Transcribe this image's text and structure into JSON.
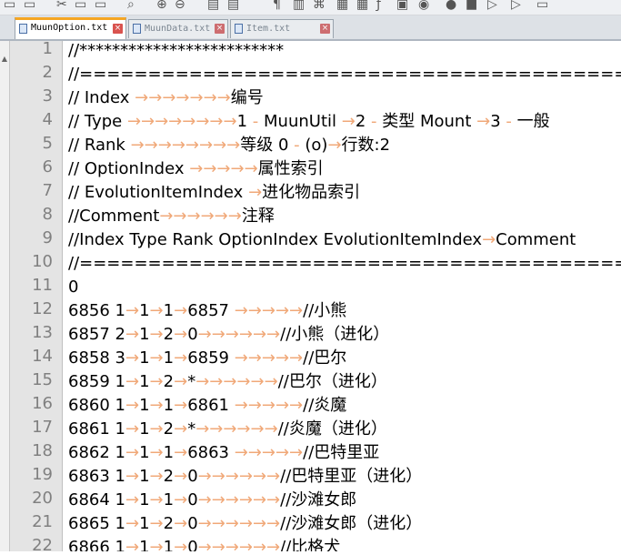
{
  "tabs": [
    {
      "label": "MuunOption.txt",
      "active": true
    },
    {
      "label": "MuunData.txt",
      "active": false
    },
    {
      "label": "Item.txt",
      "active": false
    }
  ],
  "close_glyph": "×",
  "line_numbers": [
    "1",
    "2",
    "3",
    "4",
    "5",
    "6",
    "7",
    "8",
    "9",
    "10",
    "11",
    "12",
    "13",
    "14",
    "15",
    "16",
    "17",
    "18",
    "19",
    "20",
    "21",
    "22"
  ],
  "lines": [
    [
      {
        "t": "//*************************"
      }
    ],
    [
      {
        "t": "//==================================================="
      }
    ],
    [
      {
        "t": "//"
      },
      {
        "w": " "
      },
      {
        "t": "Index"
      },
      {
        "a": " →→→→→→→"
      },
      {
        "t": "编号"
      }
    ],
    [
      {
        "t": "//"
      },
      {
        "w": " "
      },
      {
        "t": "Type"
      },
      {
        "a": " →→→→→→→→"
      },
      {
        "t": "1"
      },
      {
        "w": " - "
      },
      {
        "t": "MuunUtil"
      },
      {
        "a": " →"
      },
      {
        "t": "2"
      },
      {
        "w": " - "
      },
      {
        "t": "类型"
      },
      {
        "w": " "
      },
      {
        "t": "Mount"
      },
      {
        "a": " →"
      },
      {
        "t": "3"
      },
      {
        "w": " - "
      },
      {
        "t": "一般"
      }
    ],
    [
      {
        "t": "//"
      },
      {
        "w": " "
      },
      {
        "t": "Rank"
      },
      {
        "a": " →→→→→→→→"
      },
      {
        "t": "等级"
      },
      {
        "w": " "
      },
      {
        "t": "0"
      },
      {
        "w": " - "
      },
      {
        "t": "(o)"
      },
      {
        "a": "→"
      },
      {
        "t": "行数:2"
      }
    ],
    [
      {
        "t": "//"
      },
      {
        "w": " "
      },
      {
        "t": "OptionIndex"
      },
      {
        "a": " →→→→→"
      },
      {
        "t": "属性索引"
      }
    ],
    [
      {
        "t": "//"
      },
      {
        "w": " "
      },
      {
        "t": "EvolutionItemIndex"
      },
      {
        "a": " →"
      },
      {
        "t": "进化物品索引"
      }
    ],
    [
      {
        "t": "//Comment"
      },
      {
        "a": "→→→→→→"
      },
      {
        "t": "注释"
      }
    ],
    [
      {
        "t": "//Index"
      },
      {
        "w": " "
      },
      {
        "t": "Type"
      },
      {
        "w": " "
      },
      {
        "t": "Rank"
      },
      {
        "w": " "
      },
      {
        "t": "OptionIndex"
      },
      {
        "w": " "
      },
      {
        "t": "EvolutionItemIndex"
      },
      {
        "a": "→"
      },
      {
        "t": "Comment"
      }
    ],
    [
      {
        "t": "//==================================================="
      }
    ],
    [
      {
        "t": "0"
      }
    ],
    [
      {
        "t": "6856"
      },
      {
        "w": " "
      },
      {
        "t": "1"
      },
      {
        "a": "→"
      },
      {
        "t": "1"
      },
      {
        "a": "→"
      },
      {
        "t": "1"
      },
      {
        "a": "→"
      },
      {
        "t": "6857"
      },
      {
        "a": " →→→→→"
      },
      {
        "t": "//小熊"
      }
    ],
    [
      {
        "t": "6857"
      },
      {
        "w": " "
      },
      {
        "t": "2"
      },
      {
        "a": "→"
      },
      {
        "t": "1"
      },
      {
        "a": "→"
      },
      {
        "t": "2"
      },
      {
        "a": "→"
      },
      {
        "t": "0"
      },
      {
        "a": "→→→→→→"
      },
      {
        "t": "//小熊（进化）"
      }
    ],
    [
      {
        "t": "6858"
      },
      {
        "w": " "
      },
      {
        "t": "3"
      },
      {
        "a": "→"
      },
      {
        "t": "1"
      },
      {
        "a": "→"
      },
      {
        "t": "1"
      },
      {
        "a": "→"
      },
      {
        "t": "6859"
      },
      {
        "a": " →→→→→"
      },
      {
        "t": "//巴尔"
      }
    ],
    [
      {
        "t": "6859"
      },
      {
        "w": " "
      },
      {
        "t": "1"
      },
      {
        "a": "→"
      },
      {
        "t": "1"
      },
      {
        "a": "→"
      },
      {
        "t": "2"
      },
      {
        "a": "→"
      },
      {
        "t": "*"
      },
      {
        "a": "→→→→→→"
      },
      {
        "t": "//巴尔（进化）"
      }
    ],
    [
      {
        "t": "6860"
      },
      {
        "w": " "
      },
      {
        "t": "1"
      },
      {
        "a": "→"
      },
      {
        "t": "1"
      },
      {
        "a": "→"
      },
      {
        "t": "1"
      },
      {
        "a": "→"
      },
      {
        "t": "6861"
      },
      {
        "a": " →→→→→"
      },
      {
        "t": "//炎魔"
      }
    ],
    [
      {
        "t": "6861"
      },
      {
        "w": " "
      },
      {
        "t": "1"
      },
      {
        "a": "→"
      },
      {
        "t": "1"
      },
      {
        "a": "→"
      },
      {
        "t": "2"
      },
      {
        "a": "→"
      },
      {
        "t": "*"
      },
      {
        "a": "→→→→→→"
      },
      {
        "t": "//炎魔（进化）"
      }
    ],
    [
      {
        "t": "6862"
      },
      {
        "w": " "
      },
      {
        "t": "1"
      },
      {
        "a": "→"
      },
      {
        "t": "1"
      },
      {
        "a": "→"
      },
      {
        "t": "1"
      },
      {
        "a": "→"
      },
      {
        "t": "6863"
      },
      {
        "a": " →→→→→"
      },
      {
        "t": "//巴特里亚"
      }
    ],
    [
      {
        "t": "6863"
      },
      {
        "w": " "
      },
      {
        "t": "1"
      },
      {
        "a": "→"
      },
      {
        "t": "1"
      },
      {
        "a": "→"
      },
      {
        "t": "2"
      },
      {
        "a": "→"
      },
      {
        "t": "0"
      },
      {
        "a": "→→→→→→"
      },
      {
        "t": "//巴特里亚（进化）"
      }
    ],
    [
      {
        "t": "6864"
      },
      {
        "w": " "
      },
      {
        "t": "1"
      },
      {
        "a": "→"
      },
      {
        "t": "1"
      },
      {
        "a": "→"
      },
      {
        "t": "1"
      },
      {
        "a": "→"
      },
      {
        "t": "0"
      },
      {
        "a": "→→→→→→"
      },
      {
        "t": "//沙滩女郎"
      }
    ],
    [
      {
        "t": "6865"
      },
      {
        "w": " "
      },
      {
        "t": "1"
      },
      {
        "a": "→"
      },
      {
        "t": "1"
      },
      {
        "a": "→"
      },
      {
        "t": "2"
      },
      {
        "a": "→"
      },
      {
        "t": "0"
      },
      {
        "a": "→→→→→→"
      },
      {
        "t": "//沙滩女郎（进化）"
      }
    ],
    [
      {
        "t": "6866"
      },
      {
        "w": " "
      },
      {
        "t": "1"
      },
      {
        "a": "→"
      },
      {
        "t": "1"
      },
      {
        "a": "→"
      },
      {
        "t": "1"
      },
      {
        "a": "→"
      },
      {
        "t": "0"
      },
      {
        "a": "→→→→→→"
      },
      {
        "t": "//比格犬"
      }
    ]
  ]
}
